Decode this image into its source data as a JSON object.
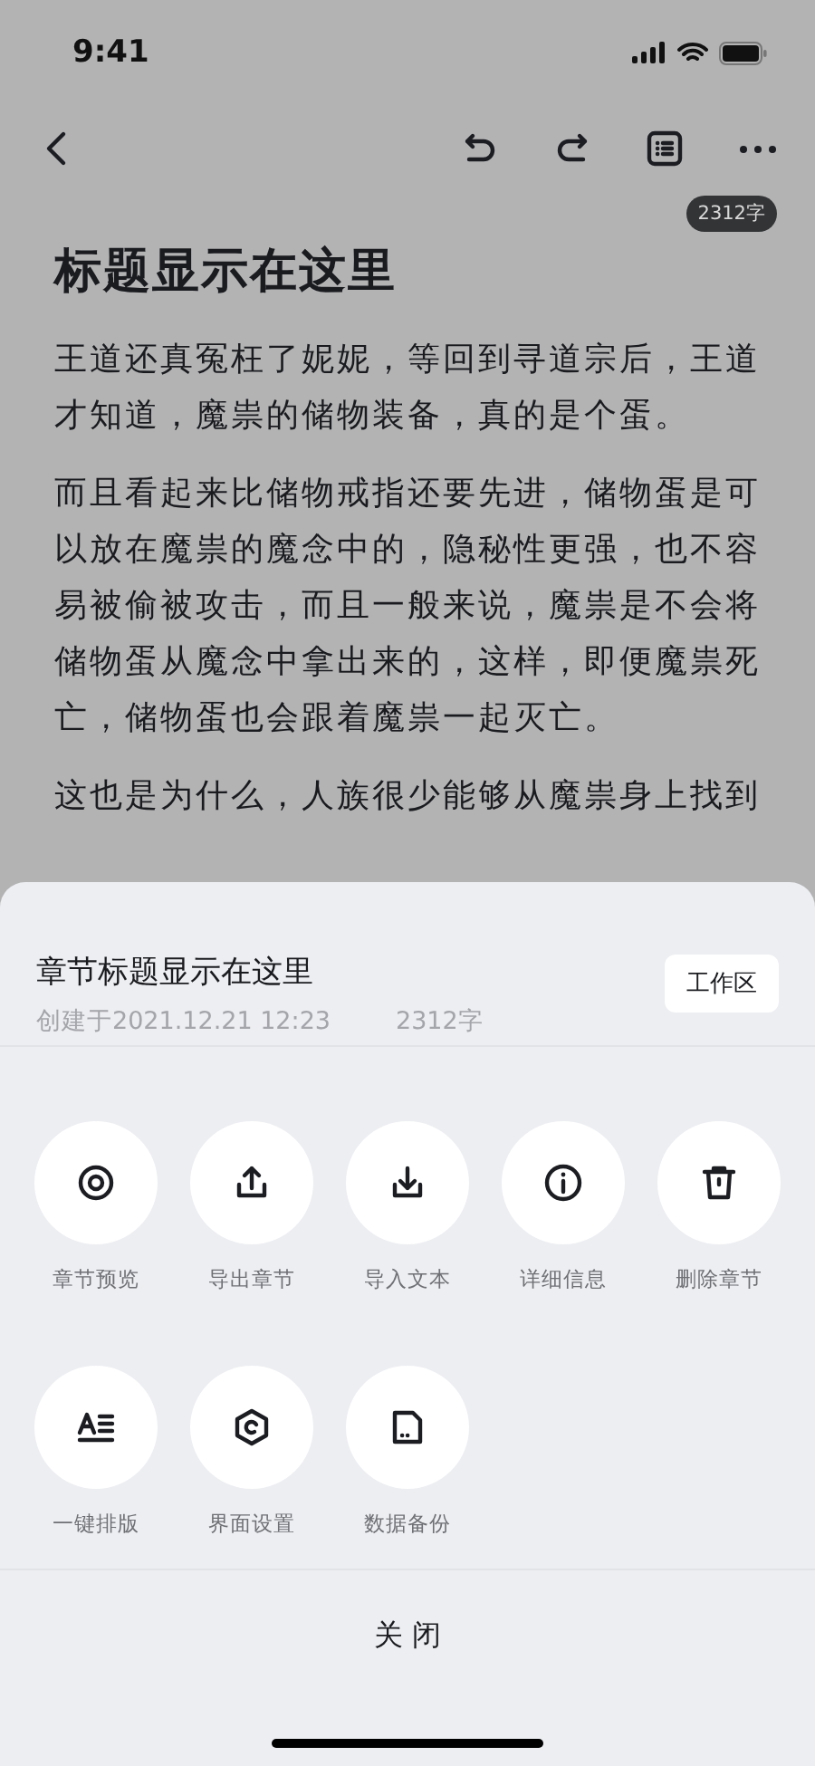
{
  "status_bar": {
    "time": "9:41"
  },
  "toolbar": {
    "word_count": "2312字"
  },
  "article": {
    "title": "标题显示在这里",
    "paragraphs": [
      "王道还真冤枉了妮妮，等回到寻道宗后，王道才知道，魔祟的储物装备，真的是个蛋。",
      "而且看起来比储物戒指还要先进，储物蛋是可以放在魔祟的魔念中的，隐秘性更强，也不容易被偷被攻击，而且一般来说，魔祟是不会将储物蛋从魔念中拿出来的，这样，即便魔祟死亡，储物蛋也会跟着魔祟一起灭亡。",
      "这也是为什么，人族很少能够从魔祟身上找到"
    ]
  },
  "sheet": {
    "chapter_title": "章节标题显示在这里",
    "created": "创建于2021.12.21 12:23",
    "word_count": "2312字",
    "workspace_button": "工作区",
    "actions": [
      {
        "label": "章节预览"
      },
      {
        "label": "导出章节"
      },
      {
        "label": "导入文本"
      },
      {
        "label": "详细信息"
      },
      {
        "label": "删除章节"
      },
      {
        "label": "一键排版"
      },
      {
        "label": "界面设置"
      },
      {
        "label": "数据备份"
      }
    ],
    "close_button": "关 闭"
  }
}
